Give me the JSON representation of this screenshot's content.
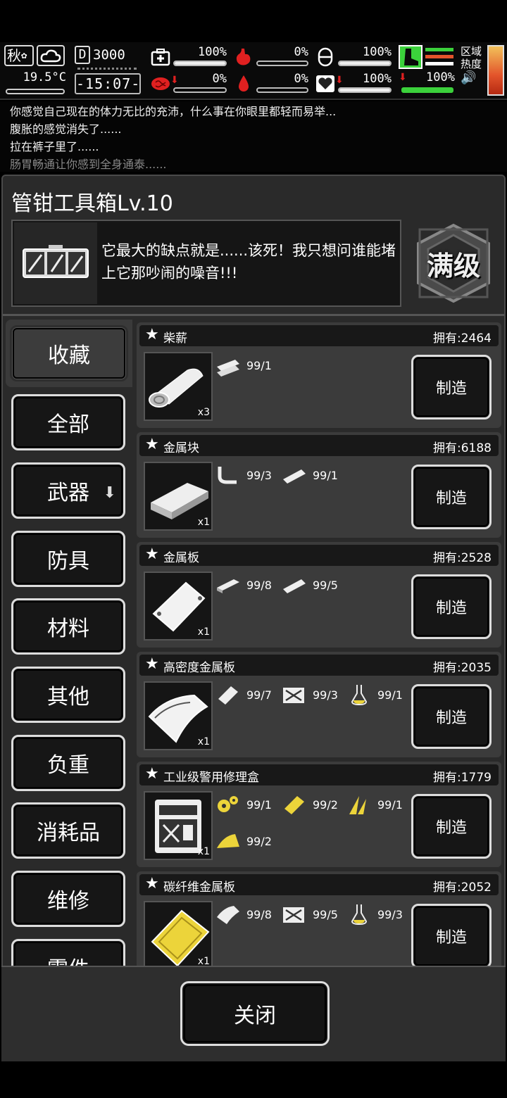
{
  "hud": {
    "season": "秋",
    "weather_icon": "cloud-icon",
    "temperature": "19.5°C",
    "day": "3000",
    "day_box": "D",
    "clock": "-15:07-",
    "stats": [
      {
        "name": "health",
        "icon": "medkit-icon",
        "value": "100%",
        "fill": 1.0
      },
      {
        "name": "hunger",
        "icon": "stomach-icon",
        "value": "0%",
        "fill": 0.0
      },
      {
        "name": "thirst-pill",
        "icon": "pill-icon",
        "value": "100%",
        "fill": 1.0
      },
      {
        "name": "brain",
        "icon": "brain-icon",
        "value": "0%",
        "fill": 0.0
      },
      {
        "name": "blood",
        "icon": "blood-drop-icon",
        "value": "0%",
        "fill": 0.0
      },
      {
        "name": "mood",
        "icon": "heart-icon",
        "value": "100%",
        "fill": 1.0
      }
    ],
    "stamina": "100%",
    "zone_label": "区域热度",
    "colors": {
      "red": "#e02020",
      "green": "#3bd13b",
      "orange": "#e3542b"
    }
  },
  "log": [
    "你感觉自己现在的体力无比的充沛，什么事在你眼里都轻而易举...",
    "腹胀的感觉消失了......",
    "拉在裤子里了......",
    "肠胃畅通让你感到全身通泰......"
  ],
  "panel": {
    "title": "管钳工具箱Lv.10",
    "description": "它最大的缺点就是......该死！我只想问谁能堵上它那吵闹的噪音!!!",
    "max_level": "满级"
  },
  "nav": [
    {
      "label": "收藏",
      "active": true
    },
    {
      "label": "全部"
    },
    {
      "label": "武器",
      "badge": "download-icon"
    },
    {
      "label": "防具"
    },
    {
      "label": "材料"
    },
    {
      "label": "其他"
    },
    {
      "label": "负重"
    },
    {
      "label": "消耗品"
    },
    {
      "label": "维修"
    },
    {
      "label": "零件"
    }
  ],
  "recipes": [
    {
      "name": "柴薪",
      "owned": "拥有:2464",
      "qty": "x3",
      "materials": [
        {
          "icon": "logs-icon",
          "amount": "99/1"
        }
      ],
      "make": "制造"
    },
    {
      "name": "金属块",
      "owned": "拥有:6188",
      "qty": "x1",
      "materials": [
        {
          "icon": "scrap-pipe-icon",
          "amount": "99/3"
        },
        {
          "icon": "log-icon",
          "amount": "99/1"
        }
      ],
      "make": "制造"
    },
    {
      "name": "金属板",
      "owned": "拥有:2528",
      "qty": "x1",
      "materials": [
        {
          "icon": "metal-block-icon",
          "amount": "99/8"
        },
        {
          "icon": "log-icon",
          "amount": "99/5"
        }
      ],
      "make": "制造"
    },
    {
      "name": "高密度金属板",
      "owned": "拥有:2035",
      "qty": "x1",
      "materials": [
        {
          "icon": "metal-plate-icon",
          "amount": "99/7"
        },
        {
          "icon": "canister-icon",
          "amount": "99/3"
        },
        {
          "icon": "flask-icon",
          "amount": "99/1"
        }
      ],
      "make": "制造"
    },
    {
      "name": "工业级警用修理盒",
      "owned": "拥有:1779",
      "qty": "x1",
      "materials": [
        {
          "icon": "gears-icon",
          "amount": "99/1"
        },
        {
          "icon": "gold-plate-icon",
          "amount": "99/2"
        },
        {
          "icon": "shards-icon",
          "amount": "99/1"
        },
        {
          "icon": "gold-sheet-icon",
          "amount": "99/2"
        }
      ],
      "make": "制造"
    },
    {
      "name": "碳纤维金属板",
      "owned": "拥有:2052",
      "qty": "x1",
      "materials": [
        {
          "icon": "dense-plate-icon",
          "amount": "99/8"
        },
        {
          "icon": "canister-icon",
          "amount": "99/5"
        },
        {
          "icon": "flask-icon",
          "amount": "99/3"
        }
      ],
      "make": "制造"
    }
  ],
  "close_label": "关闭"
}
